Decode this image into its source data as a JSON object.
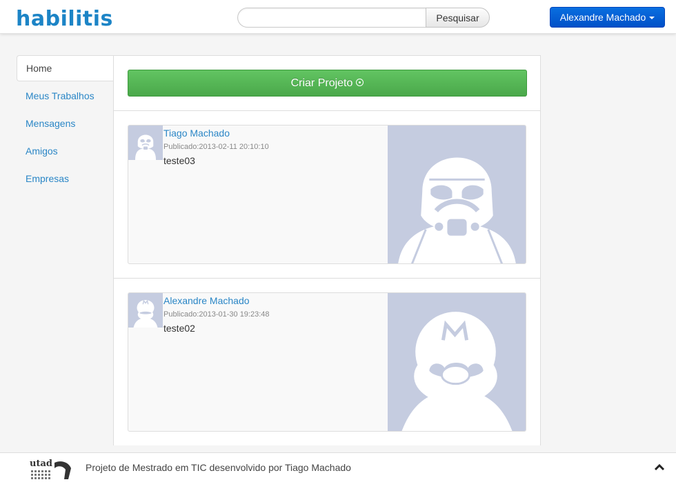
{
  "navbar": {
    "brand": "habilitis",
    "search": {
      "placeholder": "",
      "value": "",
      "button_label": "Pesquisar"
    },
    "user_menu_label": "Alexandre Machado"
  },
  "sidebar": {
    "items": [
      {
        "label": "Home",
        "active": true
      },
      {
        "label": "Meus Trabalhos"
      },
      {
        "label": "Mensagens"
      },
      {
        "label": "Amigos"
      },
      {
        "label": "Empresas"
      }
    ]
  },
  "main": {
    "create_button_label": "Criar Projeto",
    "posts": [
      {
        "author": "Tiago Machado",
        "published": "Publicado:2013-02-11 20:10:10",
        "text": "teste03",
        "avatar": "stormtrooper-avatar"
      },
      {
        "author": "Alexandre Machado",
        "published": "Publicado:2013-01-30 19:23:48",
        "text": "teste02",
        "avatar": "mario-avatar"
      }
    ]
  },
  "footer": {
    "logo_text": "utad",
    "text": "Projeto de Mestrado em TIC desenvolvido por Tiago Machado"
  },
  "colors": {
    "brand": "#1c84c6",
    "link": "#2a86c6",
    "primary_button": "#0a6fe0",
    "success_button": "#5bb75b",
    "avatar_bg": "#c5cce0"
  }
}
